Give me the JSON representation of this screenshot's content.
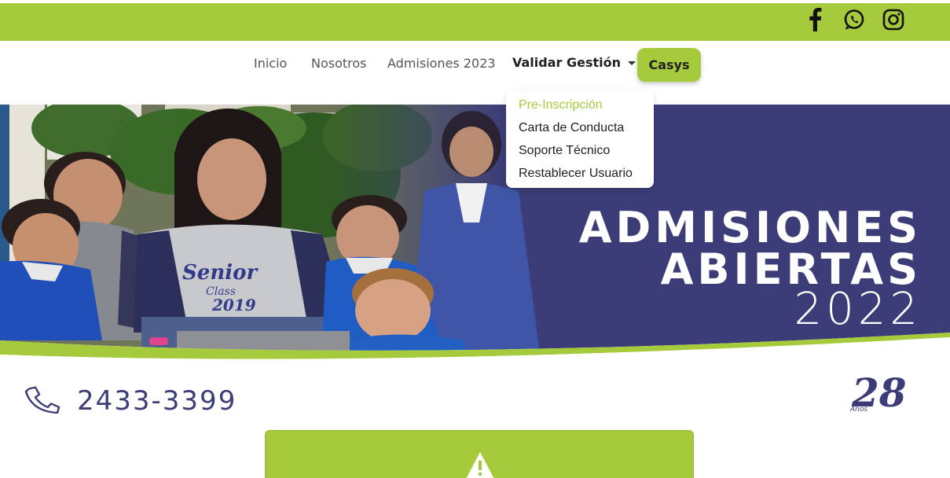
{
  "social": {
    "icons": [
      "facebook-icon",
      "whatsapp-icon",
      "instagram-icon"
    ]
  },
  "nav": {
    "items": [
      "Inicio",
      "Nosotros",
      "Admisiones 2023"
    ],
    "dropdown_label": "Validar Gestión",
    "casys_label": "Casys"
  },
  "dropdown": {
    "items": [
      "Pre-Inscripción",
      "Carta de Conducta",
      "Soporte Técnico",
      "Restablecer Usuario"
    ],
    "active_index": 0
  },
  "hero": {
    "line1": "ADMISIONES",
    "line2": "ABIERTAS",
    "line3": "2022",
    "shirt_text1": "Senior",
    "shirt_text2": "Class",
    "shirt_text3": "2019"
  },
  "contact": {
    "phone": "2433-3399"
  },
  "anniversary": {
    "number": "28",
    "label": "Años"
  },
  "colors": {
    "brand_green": "#a5cb3c",
    "brand_navy": "#3c3d78"
  }
}
